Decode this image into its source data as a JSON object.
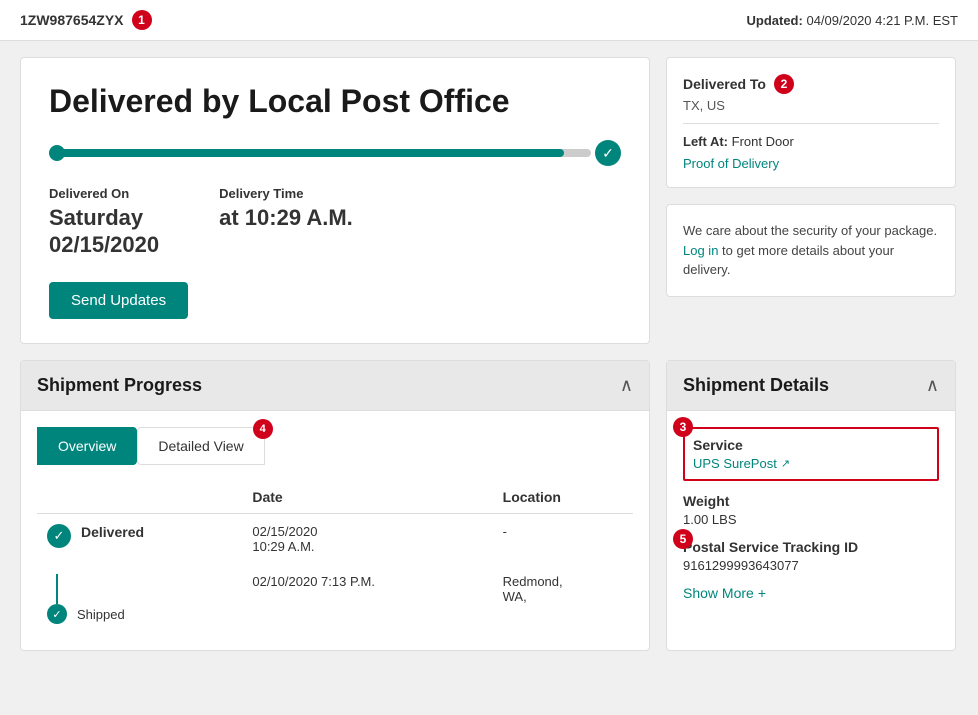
{
  "topbar": {
    "tracking_number": "1ZW987654ZYX",
    "badge1": "1",
    "updated_label": "Updated:",
    "updated_value": "04/09/2020 4:21 P.M. EST"
  },
  "delivery_card": {
    "title": "Delivered by Local Post Office",
    "delivered_on_label": "Delivered On",
    "delivered_date": "Saturday\n02/15/2020",
    "delivered_date_line1": "Saturday",
    "delivered_date_line2": "02/15/2020",
    "delivery_time_label": "Delivery Time",
    "delivery_time_value": "at 10:29 A.M.",
    "send_updates_btn": "Send Updates"
  },
  "delivered_to_card": {
    "title": "Delivered To",
    "badge": "2",
    "location": "TX, US",
    "left_at_label": "Left At:",
    "left_at_value": "Front Door",
    "proof_link": "Proof of Delivery"
  },
  "security_card": {
    "text_before_link": "We care about the security of your package.",
    "link_text": "Log in",
    "text_after_link": "to get more details about your delivery."
  },
  "shipment_progress": {
    "title": "Shipment Progress",
    "tabs": [
      {
        "label": "Overview",
        "active": true
      },
      {
        "label": "Detailed View",
        "active": false
      }
    ],
    "tab_badge": "4",
    "table": {
      "headers": [
        "",
        "Date",
        "Location"
      ],
      "rows": [
        {
          "status": "Delivered",
          "status_bold": true,
          "date": "02/15/2020\n10:29 A.M.",
          "date_line1": "02/15/2020",
          "date_line2": "10:29 A.M.",
          "location": "-",
          "icon": "check"
        },
        {
          "status": "Shipped",
          "status_bold": false,
          "date": "02/10/2020  7:13 P.M.",
          "date_line1": "02/10/2020  7:13 P.M.",
          "date_line2": "",
          "location": "Redmond,\nWA,",
          "location_line1": "Redmond,",
          "location_line2": "WA,",
          "icon": "check-small"
        }
      ]
    }
  },
  "shipment_details": {
    "title": "Shipment Details",
    "badge3": "3",
    "badge5": "5",
    "service_label": "Service",
    "service_value": "UPS SurePost",
    "service_link_icon": "↗",
    "weight_label": "Weight",
    "weight_value": "1.00 LBS",
    "postal_label": "Postal Service Tracking ID",
    "postal_value": "9161299993643077",
    "show_more_label": "Show More",
    "show_more_icon": "+"
  }
}
